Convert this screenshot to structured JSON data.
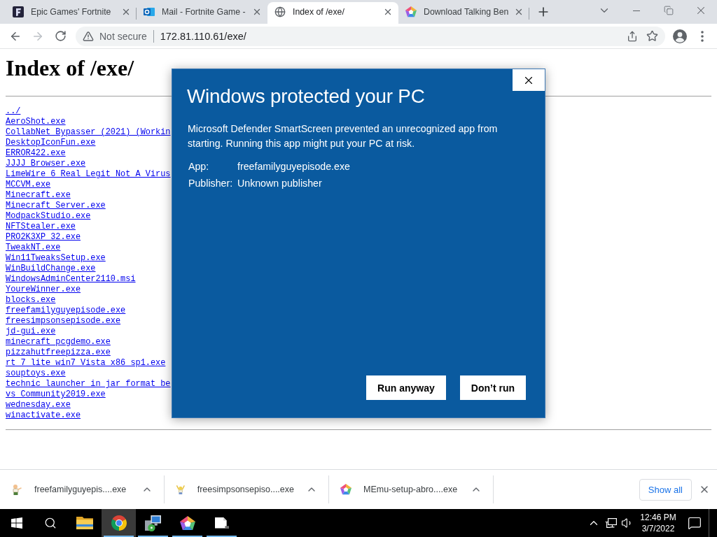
{
  "browser": {
    "tabs": [
      {
        "kind": "game",
        "title": "Epic Games' Fortnite",
        "selected": false
      },
      {
        "kind": "mail",
        "title": "Mail - Fortnite Game -",
        "selected": false
      },
      {
        "kind": "globe",
        "title": "Index of /exe/",
        "selected": true
      },
      {
        "kind": "pentagon",
        "title": "Download Talking Ben",
        "selected": false
      }
    ],
    "nav": [
      {
        "kind": "back",
        "disabled": false
      },
      {
        "kind": "forward",
        "disabled": true
      },
      {
        "kind": "reload",
        "disabled": false
      }
    ],
    "address_bar": {
      "security": "Not secure",
      "url": "172.81.110.61/exe/"
    }
  },
  "page": {
    "heading": "Index of /exe/",
    "files": [
      "../",
      "AeroShot.exe",
      "CollabNet Bypasser (2021) (Workin",
      "DesktopIconFun.exe",
      "ERROR422.exe",
      "JJJJ_Browser.exe",
      "LimeWire 6 Real Legit Not A Virus",
      "MCCVM.exe",
      "Minecraft.exe",
      "Minecraft_Server.exe",
      "ModpackStudio.exe",
      "NFTStealer.exe",
      "PRO2K3XP_32.exe",
      "TweakNT.exe",
      "Win11TweaksSetup.exe",
      "WinBuildChange.exe",
      "WindowsAdminCenter2110.msi",
      "YoureWinner.exe",
      "blocks.exe",
      "freefamilyguyepisode.exe",
      "freesimpsonsepisode.exe",
      "jd-gui.exe",
      "minecraft_pcgdemo.exe",
      "pizzahutfreepizza.exe",
      "rt_7_lite_win7_Vista_x86_sp1.exe",
      "souptoys.exe",
      "technic launcher in jar format be",
      "vs_Community2019.exe",
      "wednesday.exe",
      "winactivate.exe"
    ]
  },
  "dialog": {
    "title": "Windows protected your PC",
    "message": "Microsoft Defender SmartScreen prevented an unrecognized app from starting. Running this app might put your PC at risk.",
    "details": [
      {
        "label": "App:",
        "value": "freefamilyguyepisode.exe"
      },
      {
        "label": "Publisher:",
        "value": "Unknown publisher"
      }
    ],
    "buttons": [
      "Run anyway",
      "Don’t run"
    ]
  },
  "downloads": {
    "items": [
      {
        "kind": "figure",
        "name": "freefamilyguyepis....exe"
      },
      {
        "kind": "cheer",
        "name": "freesimpsonsepiso....exe"
      },
      {
        "kind": "pentagon",
        "name": "MEmu-setup-abro....exe"
      }
    ],
    "show_all": "Show all"
  },
  "taskbar": {
    "apps": [
      {
        "kind": "folder",
        "running": false,
        "selected": false
      },
      {
        "kind": "browser",
        "running": true,
        "selected": true
      },
      {
        "kind": "installer",
        "running": true,
        "selected": false
      },
      {
        "kind": "pentagon",
        "running": true,
        "selected": false
      },
      {
        "kind": "file",
        "running": true,
        "selected": false
      }
    ],
    "time": "12:46 PM",
    "date": "3/7/2022"
  }
}
